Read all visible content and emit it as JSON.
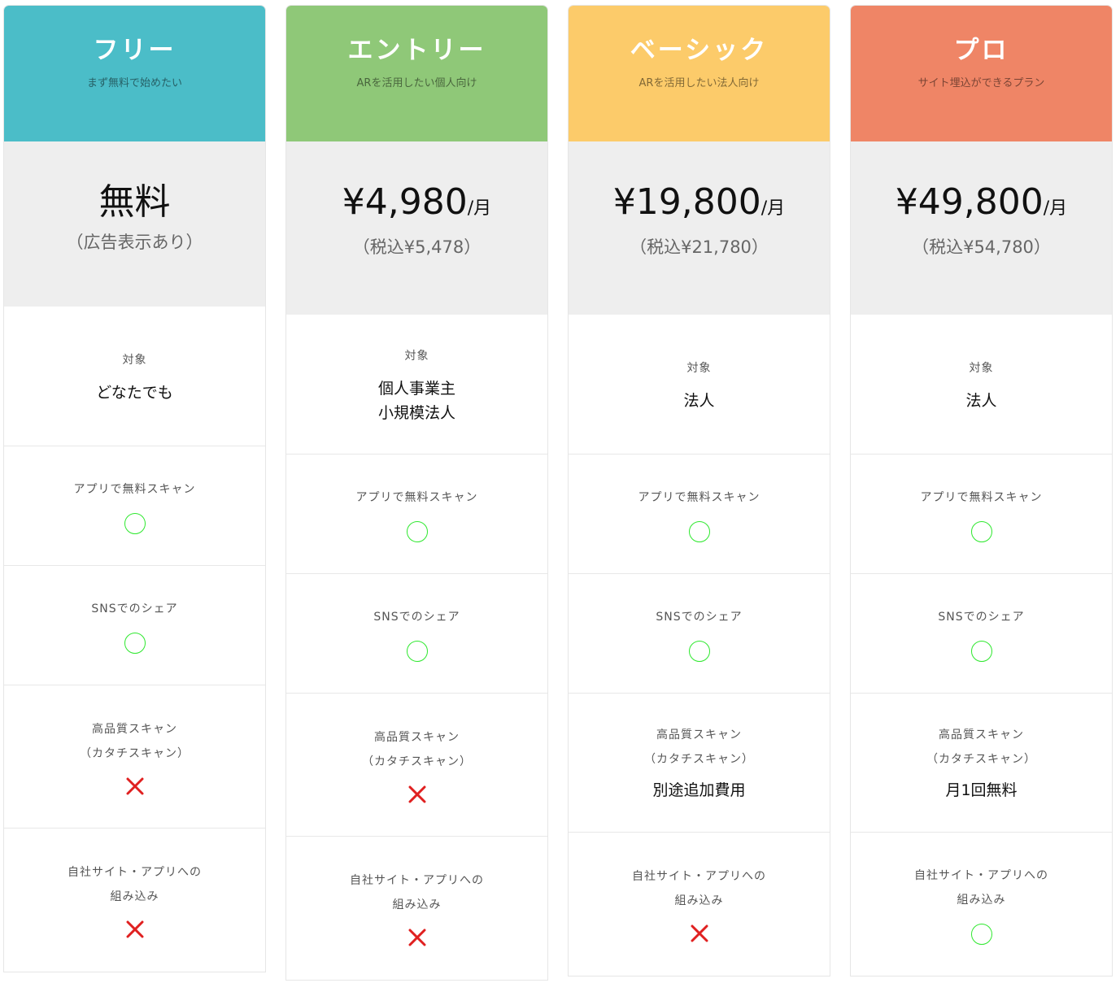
{
  "colors": {
    "free": "#4bbdc8",
    "entry": "#8fc878",
    "basic": "#fccb6a",
    "pro": "#ef8566",
    "circle": "#2ee82e",
    "cross": "#e02020"
  },
  "plans": [
    {
      "name": "フリー",
      "sub": "まず無料で始めたい",
      "price": "無料",
      "unit": "",
      "price_note": "（広告表示あり）",
      "target_label": "対象",
      "target": "どなたでも",
      "app_scan_label": "アプリで無料スキャン",
      "app_scan": "circle-icon",
      "sns_label": "SNSでのシェア",
      "sns": "circle-icon",
      "hq_label_1": "高品質スキャン",
      "hq_label_2": "（カタチスキャン）",
      "hq": "cross-icon",
      "hq_text": "",
      "embed_label_1": "自社サイト・アプリへの",
      "embed_label_2": "組み込み",
      "embed": "cross-icon"
    },
    {
      "name": "エントリー",
      "sub": "ARを活用したい個人向け",
      "price": "¥4,980",
      "unit": "/月",
      "price_note": "（税込¥5,478）",
      "target_label": "対象",
      "target": "個人事業主",
      "target_2": "小規模法人",
      "app_scan_label": "アプリで無料スキャン",
      "app_scan": "circle-icon",
      "sns_label": "SNSでのシェア",
      "sns": "circle-icon",
      "hq_label_1": "高品質スキャン",
      "hq_label_2": "（カタチスキャン）",
      "hq": "cross-icon",
      "hq_text": "",
      "embed_label_1": "自社サイト・アプリへの",
      "embed_label_2": "組み込み",
      "embed": "cross-icon"
    },
    {
      "name": "ベーシック",
      "sub": "ARを活用したい法人向け",
      "price": "¥19,800",
      "unit": "/月",
      "price_note": "（税込¥21,780）",
      "target_label": "対象",
      "target": "法人",
      "app_scan_label": "アプリで無料スキャン",
      "app_scan": "circle-icon",
      "sns_label": "SNSでのシェア",
      "sns": "circle-icon",
      "hq_label_1": "高品質スキャン",
      "hq_label_2": "（カタチスキャン）",
      "hq": "text",
      "hq_text": "別途追加費用",
      "embed_label_1": "自社サイト・アプリへの",
      "embed_label_2": "組み込み",
      "embed": "cross-icon"
    },
    {
      "name": "プロ",
      "sub": "サイト埋込ができるプラン",
      "price": "¥49,800",
      "unit": "/月",
      "price_note": "（税込¥54,780）",
      "target_label": "対象",
      "target": "法人",
      "app_scan_label": "アプリで無料スキャン",
      "app_scan": "circle-icon",
      "sns_label": "SNSでのシェア",
      "sns": "circle-icon",
      "hq_label_1": "高品質スキャン",
      "hq_label_2": "（カタチスキャン）",
      "hq": "text",
      "hq_text": "月1回無料",
      "embed_label_1": "自社サイト・アプリへの",
      "embed_label_2": "組み込み",
      "embed": "circle-icon"
    }
  ]
}
